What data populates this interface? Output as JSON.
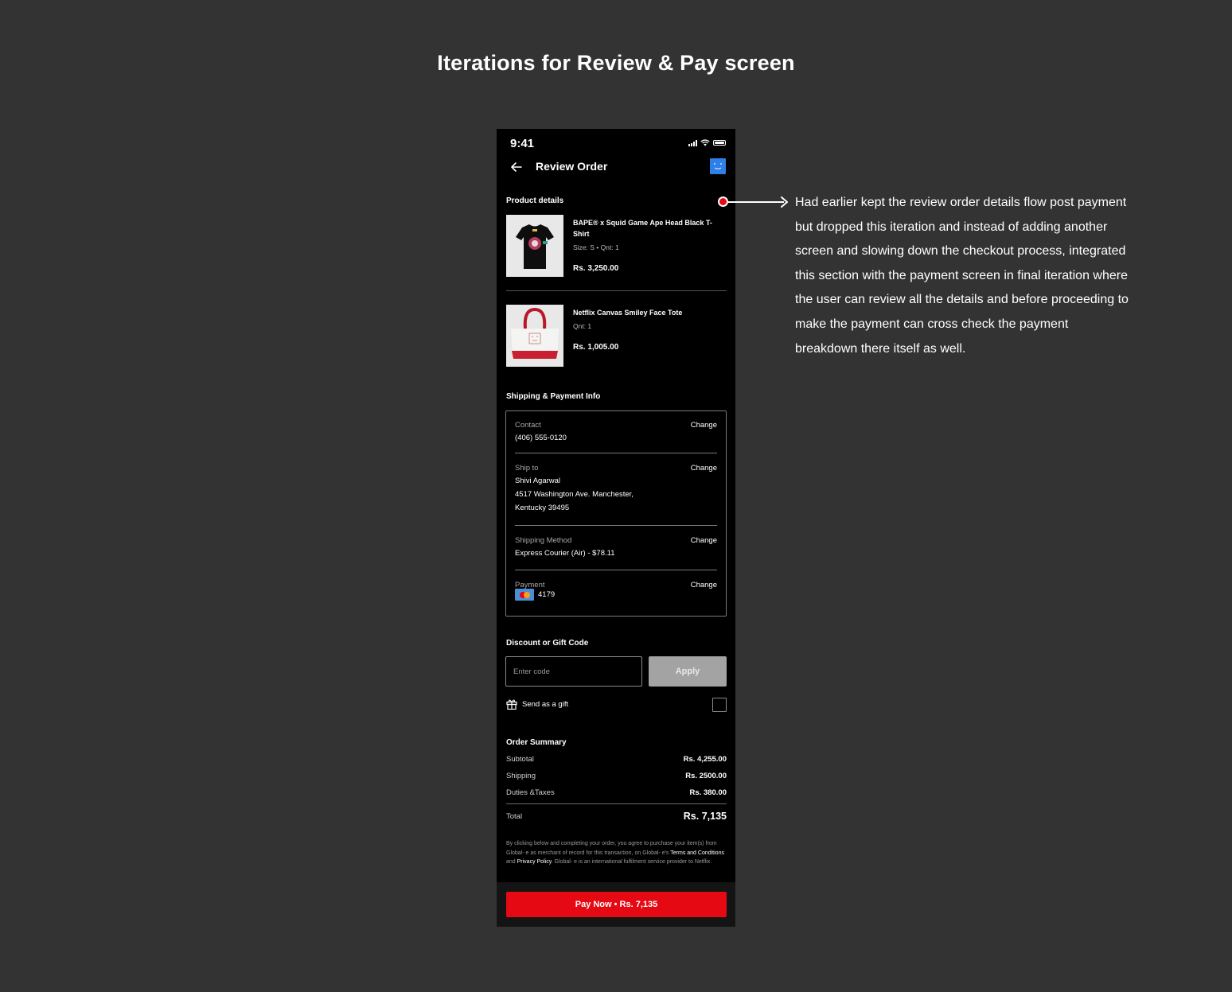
{
  "page": {
    "title": "Iterations for Review & Pay screen"
  },
  "status_bar": {
    "time": "9:41"
  },
  "nav": {
    "title": "Review Order",
    "back_icon": "arrow-left-icon",
    "avatar_icon": "smiley-profile-icon"
  },
  "product_details": {
    "label": "Product details",
    "items": [
      {
        "name": "BAPE® x Squid Game Ape Head Black T-Shirt",
        "meta": "Size: S  •  Qnt: 1",
        "price": "Rs. 3,250.00"
      },
      {
        "name": "Netflix Canvas Smiley Face Tote",
        "meta": "Qnt: 1",
        "price": "Rs. 1,005.00"
      }
    ]
  },
  "shipping_payment": {
    "label": "Shipping & Payment Info",
    "change_label": "Change",
    "contact": {
      "label": "Contact",
      "value": "(406) 555-0120"
    },
    "ship_to": {
      "label": "Ship to",
      "name": "Shivi Agarwal",
      "address_line1": "4517 Washington Ave. Manchester,",
      "address_line2": "Kentucky 39495"
    },
    "shipping_method": {
      "label": "Shipping Method",
      "value": "Express Courier (Air) - $78.11"
    },
    "payment": {
      "label": "Payment",
      "card_icon": "mastercard-icon",
      "value": "4179"
    }
  },
  "discount": {
    "label": "Discount or Gift Code",
    "placeholder": "Enter code",
    "value": "",
    "apply_label": "Apply"
  },
  "gift": {
    "label": "Send as a gift",
    "checked": false
  },
  "order_summary": {
    "label": "Order Summary",
    "rows": [
      {
        "label": "Subtotal",
        "value": "Rs. 4,255.00"
      },
      {
        "label": "Shipping",
        "value": "Rs. 2500.00"
      },
      {
        "label": "Duties &Taxes",
        "value": "Rs. 380.00"
      }
    ],
    "total_label": "Total",
    "total_value": "Rs. 7,135"
  },
  "legal": {
    "part1": "By clicking below and completing your order, you agree to purchase your item(s) from Global- e as merchant of record for this transaction, on Global- e's ",
    "terms_link": "Terms and Conditions",
    "part2": " and ",
    "privacy_link": "Privacy Policy",
    "part3": ". Global- e is an international fulfilment service provider to Netflix."
  },
  "pay_button": {
    "label": "Pay Now  •  Rs. 7,135"
  },
  "annotation": {
    "text": "Had earlier kept the review order details flow post payment but dropped this iteration and instead of adding another screen and slowing down the checkout process, integrated this section with the payment screen in final iteration where the user can review all the details and before proceeding to make the payment can cross check the payment breakdown there itself as well."
  },
  "colors": {
    "background": "#333333",
    "phone_background": "#000000",
    "brand_red": "#e50914",
    "avatar_blue": "#2f7fe8",
    "apply_disabled": "#a3a3a3"
  }
}
